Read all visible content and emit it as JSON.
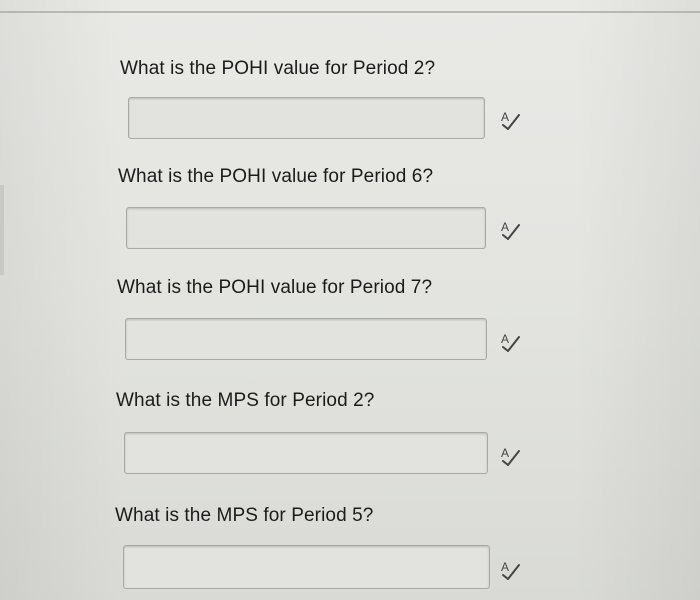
{
  "questions": [
    {
      "label": "What is the POHI value for Period 2?",
      "value": "",
      "icon": "spellcheck-icon"
    },
    {
      "label": "What is the POHI value for Period 6?",
      "value": "",
      "icon": "spellcheck-icon"
    },
    {
      "label": "What is the POHI value for Period 7?",
      "value": "",
      "icon": "spellcheck-icon"
    },
    {
      "label": "What is the MPS for Period 2?",
      "value": "",
      "icon": "spellcheck-icon"
    },
    {
      "label": "What is the MPS for Period 5?",
      "value": "",
      "icon": "spellcheck-icon"
    }
  ]
}
